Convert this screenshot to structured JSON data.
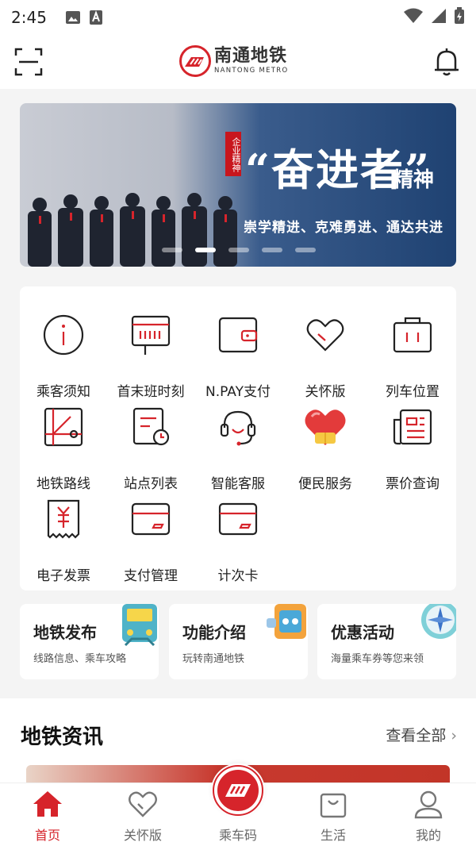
{
  "status_bar": {
    "time": "2:45"
  },
  "header": {
    "logo_cn": "南通地铁",
    "logo_en": "NANTONG METRO"
  },
  "banner": {
    "tag": "企业精神",
    "headline": "“奋进者”",
    "headline_suffix": "精神",
    "slogan": "崇学精进、克难勇进、通达共进",
    "slide_count": 5,
    "active_slide": 2
  },
  "grid": {
    "items": [
      {
        "label": "乘客须知",
        "icon": "info-icon"
      },
      {
        "label": "首末班时刻",
        "icon": "timetable-icon"
      },
      {
        "label": "N.PAY支付",
        "icon": "wallet-icon"
      },
      {
        "label": "关怀版",
        "icon": "heart-icon"
      },
      {
        "label": "列车位置",
        "icon": "train-position-icon"
      },
      {
        "label": "地铁路线",
        "icon": "route-map-icon"
      },
      {
        "label": "站点列表",
        "icon": "station-list-icon"
      },
      {
        "label": "智能客服",
        "icon": "headset-icon"
      },
      {
        "label": "便民服务",
        "icon": "service-heart-icon"
      },
      {
        "label": "票价查询",
        "icon": "fare-newspaper-icon"
      },
      {
        "label": "电子发票",
        "icon": "invoice-icon"
      },
      {
        "label": "支付管理",
        "icon": "card-icon"
      },
      {
        "label": "计次卡",
        "icon": "count-card-icon"
      }
    ]
  },
  "cards": [
    {
      "title": "地铁发布",
      "subtitle": "线路信息、乘车攻略",
      "icon": "train-illustration-icon"
    },
    {
      "title": "功能介绍",
      "subtitle": "玩转南通地铁",
      "icon": "feature-illustration-icon"
    },
    {
      "title": "优惠活动",
      "subtitle": "海量乘车券等您来领",
      "icon": "compass-illustration-icon"
    }
  ],
  "news": {
    "title": "地铁资讯",
    "more": "查看全部"
  },
  "tabbar": {
    "tabs": [
      {
        "label": "首页",
        "icon": "home-icon"
      },
      {
        "label": "关怀版",
        "icon": "heart-icon"
      },
      {
        "label": "乘车码",
        "icon": "ride-code-icon"
      },
      {
        "label": "生活",
        "icon": "shopping-bag-icon"
      },
      {
        "label": "我的",
        "icon": "profile-icon"
      }
    ],
    "active": "首页"
  },
  "colors": {
    "brand": "#d6242b",
    "banner_blue": "#1f4272"
  }
}
